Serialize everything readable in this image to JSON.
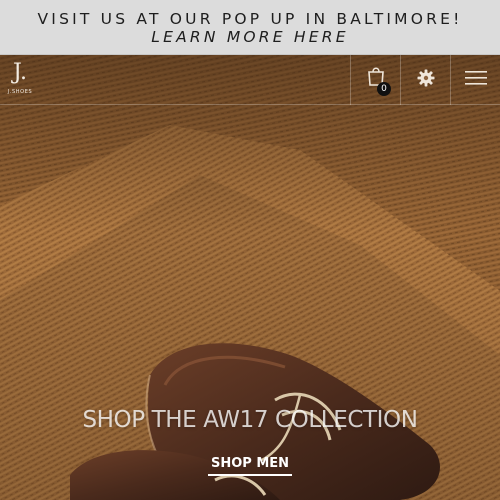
{
  "announcement": {
    "text": "VISIT US AT OUR POP UP IN BALTIMORE!",
    "link_text": "LEARN MORE HERE"
  },
  "header": {
    "logo_mark": "J.",
    "logo_word": "J.SHOES",
    "cart_count": "0",
    "icons": [
      "shopping-bag-icon",
      "gear-icon",
      "hamburger-menu-icon"
    ]
  },
  "hero": {
    "headline": "SHOP THE AW17 COLLECTION",
    "cta_label": "SHOP MEN"
  },
  "colors": {
    "announcement_bg": "#dcdcdc",
    "rug": "#a8743f",
    "leather": "#4a2a1c",
    "cta_text": "#ffffff"
  }
}
